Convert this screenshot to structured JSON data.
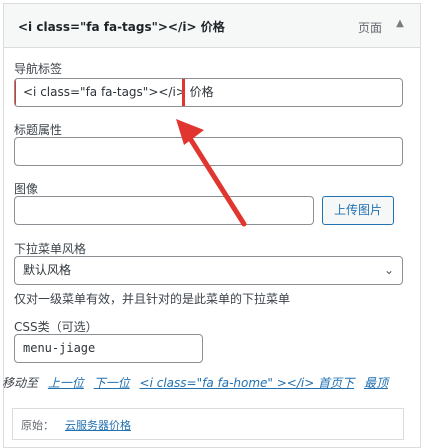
{
  "header": {
    "title": "<i class=\"fa fa-tags\"></i> 价格",
    "type_label": "页面",
    "toggle_icon": "triangle-up-icon"
  },
  "fields": {
    "nav_label": {
      "label": "导航标签",
      "value": "<i class=\"fa fa-tags\"></i> 价格"
    },
    "title_attr": {
      "label": "标题属性",
      "value": ""
    },
    "image": {
      "label": "图像",
      "value": "",
      "upload_button": "上传图片"
    },
    "dropdown_style": {
      "label": "下拉菜单风格",
      "value": "默认风格",
      "help": "仅对一级菜单有效，并且针对的是此菜单的下拉菜单"
    },
    "css_class": {
      "label": "CSS类（可选）",
      "value": "menu-jiage"
    }
  },
  "move": {
    "label": "移动至",
    "links": [
      "上一位",
      "下一位",
      "<i class=\"fa fa-home\" ></i> 首页下",
      "最顶"
    ]
  },
  "original": {
    "label": "原始：",
    "link": "云服务器价格"
  },
  "colors": {
    "highlight": "#e1352f",
    "link": "#2271b1"
  }
}
